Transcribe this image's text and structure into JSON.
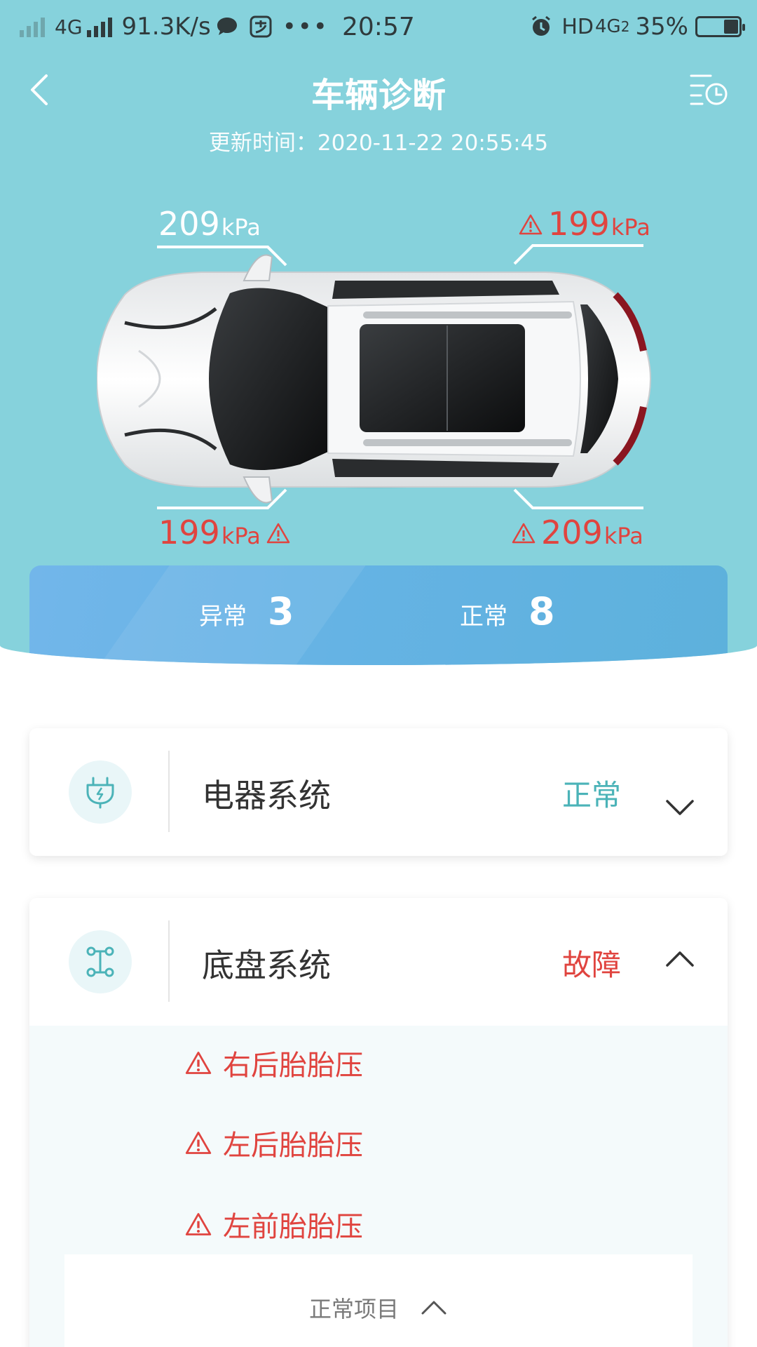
{
  "status_bar": {
    "network_left": "4G",
    "speed": "91.3K/s",
    "time": "20:57",
    "hd": "HD",
    "network_right": "4G",
    "network_right_sub": "2",
    "battery": "35%"
  },
  "header": {
    "title": "车辆诊断",
    "update_time": "更新时间：2020-11-22 20:55:45"
  },
  "tires": {
    "front_left": {
      "value": "209",
      "unit": "kPa",
      "warning": false
    },
    "front_right": {
      "value": "199",
      "unit": "kPa",
      "warning": true
    },
    "rear_left": {
      "value": "199",
      "unit": "kPa",
      "warning": true
    },
    "rear_right": {
      "value": "209",
      "unit": "kPa",
      "warning": true
    }
  },
  "summary": {
    "abnormal_label": "异常",
    "abnormal_count": "3",
    "normal_label": "正常",
    "normal_count": "8"
  },
  "systems": [
    {
      "name": "电器系统",
      "status": "正常",
      "status_color": "#4bb3b8",
      "expanded": false,
      "icon": "plug-icon"
    },
    {
      "name": "底盘系统",
      "status": "故障",
      "status_color": "#e0443f",
      "expanded": true,
      "icon": "chassis-icon",
      "faults": [
        "右后胎胎压",
        "左后胎胎压",
        "左前胎胎压"
      ],
      "normal_items_label": "正常项目"
    }
  ],
  "colors": {
    "hero_bg": "#86d2dc",
    "warning_red": "#e0443f",
    "teal": "#4bb3b8",
    "summary_blue": "#65b3e4"
  }
}
